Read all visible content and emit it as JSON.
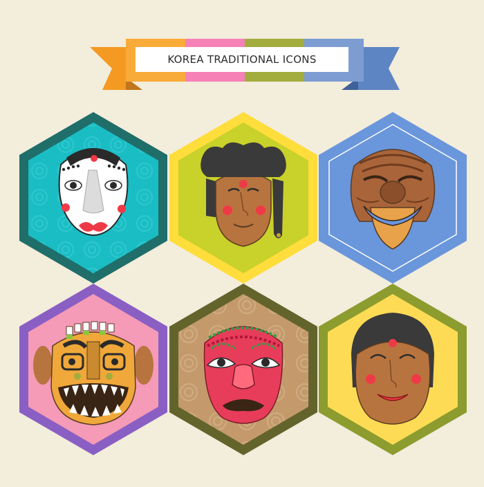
{
  "banner": {
    "title": "KOREA TRADITIONAL ICONS",
    "stripe_colors": [
      "#f9ab39",
      "#f581b6",
      "#a2ad3e",
      "#7d9dd2"
    ],
    "tail_left_color": "#f49a22",
    "tail_right_color": "#5d85c3"
  },
  "badges": [
    {
      "name": "white-mask",
      "border": "#1f6e6a",
      "fill": "#1abdc4",
      "mask_icon": "white-mask-icon"
    },
    {
      "name": "topknot-mask",
      "border": "#ffdd3b",
      "fill": "#c9d12b",
      "mask_icon": "topknot-mask-icon"
    },
    {
      "name": "laughing-old-man-mask",
      "border": "#6a96db",
      "fill": "#6a96db",
      "mask_icon": "old-man-mask-icon"
    },
    {
      "name": "grinning-demon-mask",
      "border": "#8a5fc3",
      "fill": "#f59ab7",
      "mask_icon": "demon-mask-icon"
    },
    {
      "name": "red-face-mask",
      "border": "#63642b",
      "fill": "#c49a6c",
      "mask_icon": "red-mask-icon"
    },
    {
      "name": "smiling-woman-mask",
      "border": "#8c9c2e",
      "fill": "#fddb55",
      "mask_icon": "woman-mask-icon"
    }
  ]
}
